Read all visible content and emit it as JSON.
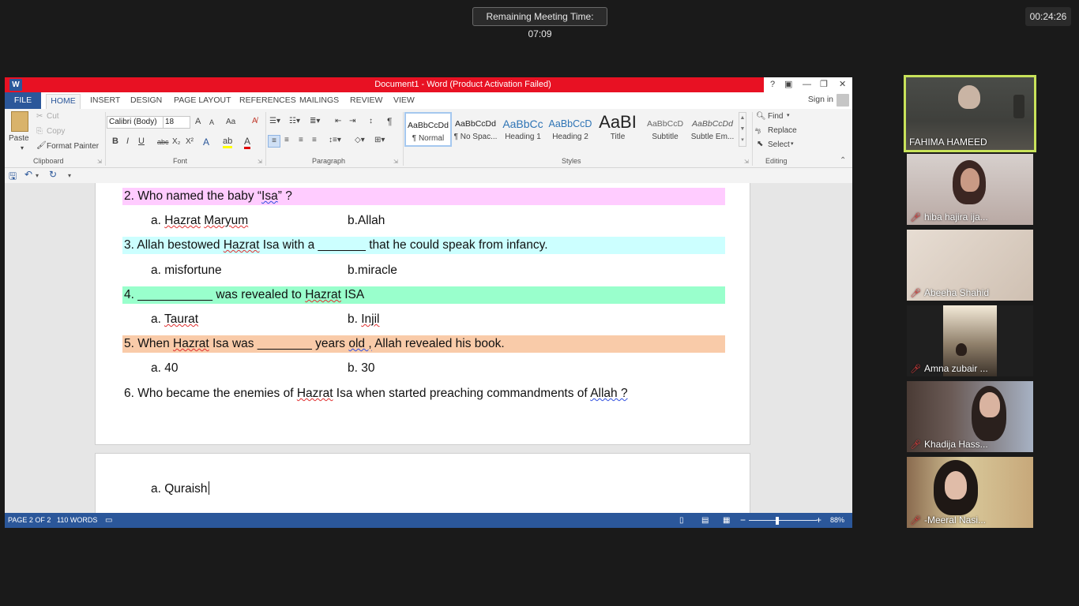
{
  "meeting": {
    "remaining": "Remaining Meeting Time: 07:09",
    "elapsed": "00:24:26"
  },
  "word": {
    "title": "Document1 -  Word (Product Activation Failed)",
    "logo": "W",
    "window_controls": [
      "?",
      "▣",
      "—",
      "❐",
      "✕"
    ],
    "tabs": [
      "FILE",
      "HOME",
      "INSERT",
      "DESIGN",
      "PAGE LAYOUT",
      "REFERENCES",
      "MAILINGS",
      "REVIEW",
      "VIEW"
    ],
    "sign_in": "Sign in",
    "clipboard": {
      "paste": "Paste",
      "cut": "Cut",
      "copy": "Copy",
      "format_painter": "Format Painter",
      "label": "Clipboard"
    },
    "font": {
      "name": "Calibri (Body)",
      "size": "18",
      "grow": "A",
      "shrink": "A",
      "case": "Aa",
      "bold": "B",
      "italic": "I",
      "underline": "U",
      "strike": "abc",
      "sub": "X₂",
      "sup": "X²",
      "label": "Font"
    },
    "paragraph": {
      "label": "Paragraph",
      "pilcrow": "¶"
    },
    "styles": {
      "items": [
        {
          "sample": "AaBbCcDd",
          "name": "¶ Normal"
        },
        {
          "sample": "AaBbCcDd",
          "name": "¶ No Spac..."
        },
        {
          "sample": "AaBbCc",
          "name": "Heading 1"
        },
        {
          "sample": "AaBbCcD",
          "name": "Heading 2"
        },
        {
          "sample": "AaBI",
          "name": "Title"
        },
        {
          "sample": "AaBbCcD",
          "name": "Subtitle"
        },
        {
          "sample": "AaBbCcDd",
          "name": "Subtle Em..."
        }
      ],
      "label": "Styles"
    },
    "editing": {
      "find": "Find",
      "replace": "Replace",
      "select": "Select",
      "label": "Editing"
    },
    "document": {
      "q2": {
        "pre": "2. Who named the baby “",
        "sq": "Isa",
        "post": "” ?"
      },
      "q2_a": {
        "pre": "a. ",
        "sq1": "Hazrat",
        "mid": " ",
        "sq2": "Maryum",
        "post": ""
      },
      "q2_b": "b.Allah",
      "q3": {
        "pre": "3. Allah bestowed ",
        "sq": "Hazrat",
        "post": " Isa with a _______ that he could speak from infancy."
      },
      "q3_a": "a. misfortune",
      "q3_b": "b.miracle",
      "q4": {
        "pre": "4. ___________ was revealed to ",
        "sq": "Hazrat",
        "post": " ISA"
      },
      "q4_a": {
        "pre": "a. ",
        "sq": "Taurat"
      },
      "q4_b": {
        "pre": "b. ",
        "sq": "Injil"
      },
      "q5": {
        "pre": "5. When ",
        "sq": "Hazrat",
        "mid": " Isa was ________ years ",
        "sqb": "old ,",
        "post": " Allah revealed his book."
      },
      "q5_a": "a. 40",
      "q5_b": "b. 30",
      "q6": {
        "pre": "6. Who became the enemies of ",
        "sq": "Hazrat",
        "mid": " Isa when started preaching commandments of ",
        "sqb": "Allah ?"
      },
      "p2_a": "a. Quraish"
    },
    "status": {
      "page": "PAGE 2 OF 2",
      "words": "110 WORDS",
      "zoom": "88%"
    }
  },
  "participants": [
    {
      "name": "FAHIMA HAMEED",
      "active": true,
      "muted": false
    },
    {
      "name": "hiba hajira ija...",
      "active": false,
      "muted": true
    },
    {
      "name": "Abeeha Shahid",
      "active": false,
      "muted": true
    },
    {
      "name": "Amna zubair ...",
      "active": false,
      "muted": true
    },
    {
      "name": "Khadija Hass...",
      "active": false,
      "muted": true
    },
    {
      "name": "-Meeral Nasi...",
      "active": false,
      "muted": true
    }
  ],
  "icons": {
    "mic_muted": "mic-off-icon"
  }
}
